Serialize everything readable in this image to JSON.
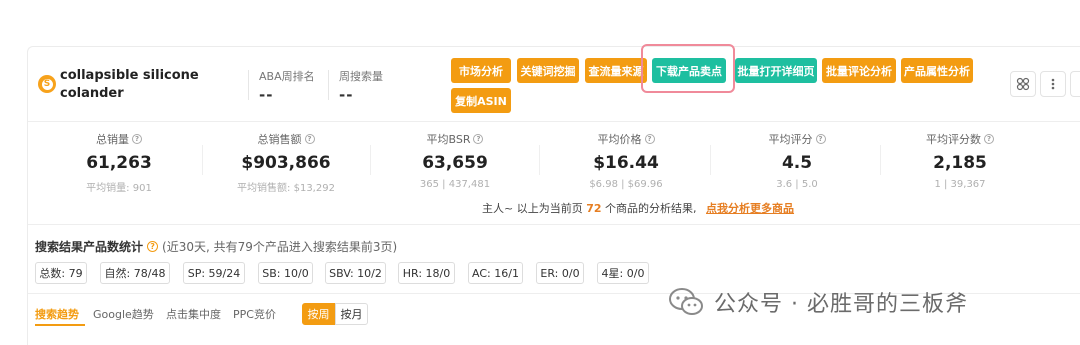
{
  "product": {
    "name": "collapsible silicone colander",
    "logo_icon": "seller-logo-icon"
  },
  "header_metrics": [
    {
      "label": "ABA周排名",
      "value": "--"
    },
    {
      "label": "周搜索量",
      "value": "--"
    }
  ],
  "toolbar": {
    "buttons": [
      {
        "label": "市场分析",
        "color": "#f39c12"
      },
      {
        "label": "关键词挖掘",
        "color": "#f39c12"
      },
      {
        "label": "查流量来源",
        "color": "#f39c12"
      },
      {
        "label": "下载产品卖点",
        "color": "#1ebfa0",
        "highlighted": true
      },
      {
        "label": "批量打开详细页",
        "color": "#1ebfa0"
      },
      {
        "label": "批量评论分析",
        "color": "#f39c12"
      },
      {
        "label": "产品属性分析",
        "color": "#f39c12"
      },
      {
        "label": "复制ASIN",
        "color": "#f39c12"
      }
    ],
    "icons": [
      "grid-icon",
      "more-icon",
      "chevron-up-icon"
    ]
  },
  "stats": [
    {
      "label": "总销量",
      "value": "61,263",
      "sub": "平均销量: 901"
    },
    {
      "label": "总销售额",
      "value": "$903,866",
      "sub": "平均销售额: $13,292"
    },
    {
      "label": "平均BSR",
      "value": "63,659",
      "sub": "365 | 437,481"
    },
    {
      "label": "平均价格",
      "value": "$16.44",
      "sub": "$6.98 | $69.96"
    },
    {
      "label": "平均评分",
      "value": "4.5",
      "sub": "3.6 | 5.0"
    },
    {
      "label": "平均评分数",
      "value": "2,185",
      "sub": "1 | 39,367"
    }
  ],
  "summary": {
    "prefix": "主人~ 以上为当前页",
    "count": "72",
    "suffix": "个商品的分析结果,",
    "link": "点我分析更多商品"
  },
  "search_stats": {
    "title": "搜索结果产品数统计",
    "note": "(近30天, 共有79个产品进入搜索结果前3页)",
    "chips": [
      "总数: 79",
      "自然: 78/48",
      "SP: 59/24",
      "SB: 10/0",
      "SBV: 10/2",
      "HR: 18/0",
      "AC: 16/1",
      "ER: 0/0",
      "4星: 0/0"
    ]
  },
  "trend_tabs": [
    "搜索趋势",
    "Google趋势",
    "点击集中度",
    "PPC竞价"
  ],
  "period_toggle": [
    "按周",
    "按月"
  ],
  "watermark": {
    "text": "公众号 · 必胜哥的三板斧",
    "icon": "wechat-icon"
  },
  "colors": {
    "accent": "#f39c12",
    "teal": "#1ebfa0",
    "highlight_border": "#f08a9a"
  }
}
